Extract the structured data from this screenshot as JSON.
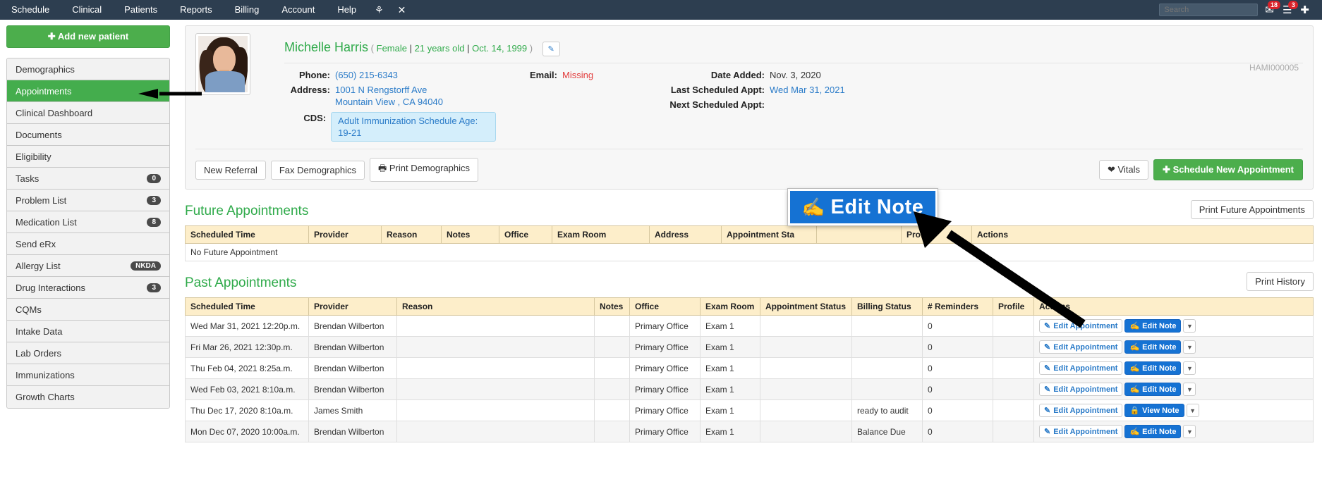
{
  "topnav": {
    "items": [
      "Schedule",
      "Clinical",
      "Patients",
      "Reports",
      "Billing",
      "Account",
      "Help"
    ],
    "caduceus_icon": "caduceus-icon",
    "close_icon": "close-icon",
    "search_placeholder": "Search",
    "mail_badge": "18",
    "menu_badge": "3",
    "plus_icon": "plus-icon"
  },
  "sidebar": {
    "add_patient_label": "Add new patient",
    "items": [
      {
        "label": "Demographics",
        "badge": "",
        "active": false
      },
      {
        "label": "Appointments",
        "badge": "",
        "active": true
      },
      {
        "label": "Clinical Dashboard",
        "badge": "",
        "active": false
      },
      {
        "label": "Documents",
        "badge": "",
        "active": false
      },
      {
        "label": "Eligibility",
        "badge": "",
        "active": false
      },
      {
        "label": "Tasks",
        "badge": "0",
        "active": false
      },
      {
        "label": "Problem List",
        "badge": "3",
        "active": false
      },
      {
        "label": "Medication List",
        "badge": "8",
        "active": false
      },
      {
        "label": "Send eRx",
        "badge": "",
        "active": false
      },
      {
        "label": "Allergy List",
        "badge": "NKDA",
        "active": false
      },
      {
        "label": "Drug Interactions",
        "badge": "3",
        "active": false
      },
      {
        "label": "CQMs",
        "badge": "",
        "active": false
      },
      {
        "label": "Intake Data",
        "badge": "",
        "active": false
      },
      {
        "label": "Lab Orders",
        "badge": "",
        "active": false
      },
      {
        "label": "Immunizations",
        "badge": "",
        "active": false
      },
      {
        "label": "Growth Charts",
        "badge": "",
        "active": false
      }
    ]
  },
  "patient": {
    "name": "Michelle Harris",
    "paren_open": "(",
    "gender": "Female",
    "age": "21 years old",
    "dob": "Oct. 14, 1999",
    "paren_close": ")",
    "edit_icon": "pencil-icon",
    "chart_id": "HAMI000005",
    "phone_label": "Phone:",
    "phone_value": "(650) 215-6343",
    "email_label": "Email:",
    "email_value": "Missing",
    "address_label": "Address:",
    "address_line1": "1001 N Rengstorff Ave",
    "address_line2": "Mountain View , CA 94040",
    "cds_label": "CDS:",
    "cds_value": "Adult Immunization Schedule Age: 19-21",
    "date_added_label": "Date Added:",
    "date_added_value": "Nov. 3, 2020",
    "last_appt_label": "Last Scheduled Appt:",
    "last_appt_value": "Wed Mar 31, 2021",
    "next_appt_label": "Next Scheduled Appt:",
    "next_appt_value": "",
    "photo_alt": "patient-photo"
  },
  "actions": {
    "new_referral": "New Referral",
    "fax_demographics": "Fax Demographics",
    "print_demographics": "Print Demographics",
    "print_icon": "printer-icon",
    "vitals": "Vitals",
    "heart_icon": "heart-icon",
    "schedule_new_appointment": "Schedule New Appointment"
  },
  "future": {
    "title": "Future Appointments",
    "print_button": "Print Future Appointments",
    "columns": [
      "Scheduled Time",
      "Provider",
      "Reason",
      "Notes",
      "Office",
      "Exam Room",
      "Address",
      "Appointment Sta",
      "",
      "Profile",
      "Actions"
    ],
    "empty_message": "No Future Appointment"
  },
  "past": {
    "title": "Past Appointments",
    "print_button": "Print History",
    "columns": [
      "Scheduled Time",
      "Provider",
      "Reason",
      "Notes",
      "Office",
      "Exam Room",
      "Appointment Status",
      "Billing Status",
      "# Reminders",
      "Profile",
      "Actions"
    ],
    "rows": [
      {
        "time": "Wed Mar 31, 2021 12:20p.m.",
        "provider": "Brendan Wilberton",
        "reason": "",
        "notes": "",
        "office": "Primary Office",
        "exam_room": "Exam 1",
        "appt_status": "",
        "billing_status": "",
        "reminders": "0",
        "profile": "",
        "edit_appointment": "Edit Appointment",
        "note_button": "Edit Note",
        "note_icon": "edit-note-icon"
      },
      {
        "time": "Fri Mar 26, 2021 12:30p.m.",
        "provider": "Brendan Wilberton",
        "reason": "",
        "notes": "",
        "office": "Primary Office",
        "exam_room": "Exam 1",
        "appt_status": "",
        "billing_status": "",
        "reminders": "0",
        "profile": "",
        "edit_appointment": "Edit Appointment",
        "note_button": "Edit Note",
        "note_icon": "edit-note-icon"
      },
      {
        "time": "Thu Feb 04, 2021 8:25a.m.",
        "provider": "Brendan Wilberton",
        "reason": "",
        "notes": "",
        "office": "Primary Office",
        "exam_room": "Exam 1",
        "appt_status": "",
        "billing_status": "",
        "reminders": "0",
        "profile": "",
        "edit_appointment": "Edit Appointment",
        "note_button": "Edit Note",
        "note_icon": "edit-note-icon"
      },
      {
        "time": "Wed Feb 03, 2021 8:10a.m.",
        "provider": "Brendan Wilberton",
        "reason": "",
        "notes": "",
        "office": "Primary Office",
        "exam_room": "Exam 1",
        "appt_status": "",
        "billing_status": "",
        "reminders": "0",
        "profile": "",
        "edit_appointment": "Edit Appointment",
        "note_button": "Edit Note",
        "note_icon": "edit-note-icon"
      },
      {
        "time": "Thu Dec 17, 2020 8:10a.m.",
        "provider": "James Smith",
        "reason": "",
        "notes": "",
        "office": "Primary Office",
        "exam_room": "Exam 1",
        "appt_status": "",
        "billing_status": "ready to audit",
        "reminders": "0",
        "profile": "",
        "edit_appointment": "Edit Appointment",
        "note_button": "View Note",
        "note_icon": "lock-icon"
      },
      {
        "time": "Mon Dec 07, 2020 10:00a.m.",
        "provider": "Brendan Wilberton",
        "reason": "",
        "notes": "",
        "office": "Primary Office",
        "exam_room": "Exam 1",
        "appt_status": "",
        "billing_status": "Balance Due",
        "reminders": "0",
        "profile": "",
        "edit_appointment": "Edit Appointment",
        "note_button": "Edit Note",
        "note_icon": "edit-note-icon"
      }
    ]
  },
  "callout": {
    "label": "Edit Note",
    "icon": "edit-note-icon"
  },
  "colors": {
    "nav_bg": "#2d3e50",
    "green": "#4cae4c",
    "link_blue": "#2a7bc8",
    "table_header": "#fdeeca",
    "badge_red": "#d9222a",
    "callout_blue": "#1572d3"
  }
}
